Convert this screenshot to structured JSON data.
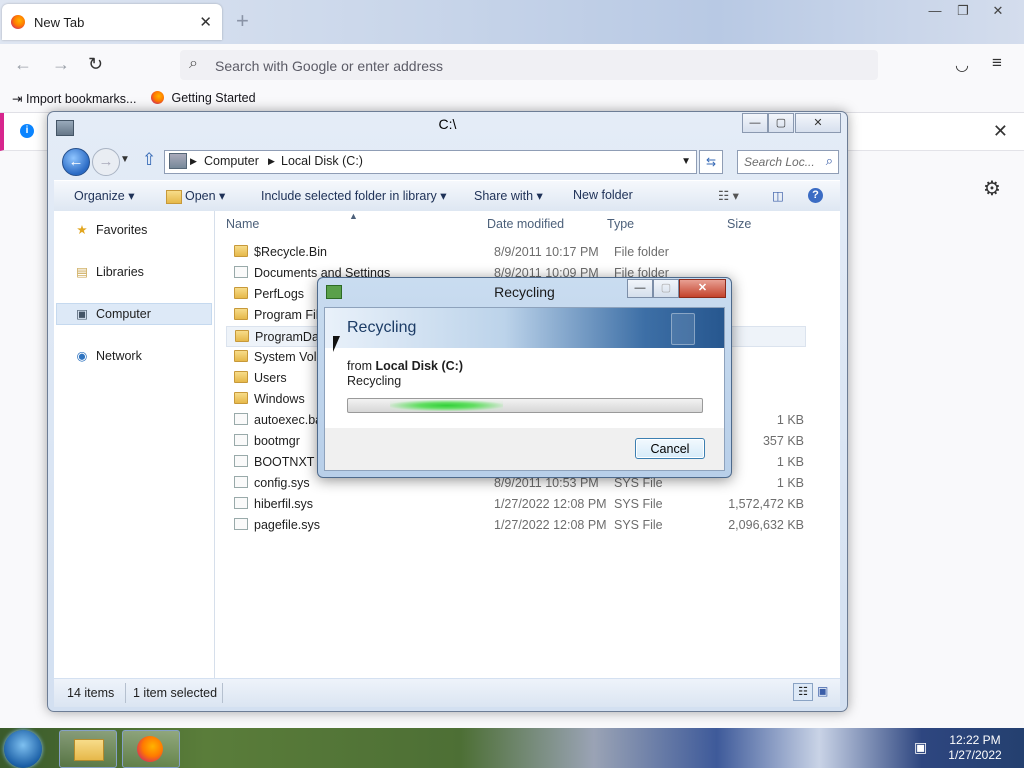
{
  "browser": {
    "tab_title": "New Tab",
    "tab_close": "✕",
    "new_tab": "+",
    "url_placeholder": "Search with Google or enter address",
    "bookmarks": [
      "Import bookmarks...",
      "Getting Started"
    ],
    "window_controls": [
      "—",
      "❐",
      "✕"
    ]
  },
  "explorer": {
    "title": "C:\\",
    "breadcrumb": [
      "Computer",
      "Local Disk (C:)"
    ],
    "search_placeholder": "Search Loc...",
    "toolbar": {
      "organize": "Organize ▾",
      "open": "Open ▾",
      "include": "Include selected folder in library ▾",
      "share": "Share with ▾",
      "new_folder": "New folder"
    },
    "nav": [
      "Favorites",
      "Libraries",
      "Computer",
      "Network"
    ],
    "columns": [
      "Name",
      "Date modified",
      "Type",
      "Size"
    ],
    "rows": [
      {
        "name": "$Recycle.Bin",
        "date": "8/9/2011 10:17 PM",
        "type": "File folder",
        "size": ""
      },
      {
        "name": "Documents and Settings",
        "date": "8/9/2011 10:09 PM",
        "type": "File folder",
        "size": ""
      },
      {
        "name": "PerfLogs",
        "date": "",
        "type": "",
        "size": ""
      },
      {
        "name": "Program Files",
        "date": "",
        "type": "",
        "size": ""
      },
      {
        "name": "ProgramData",
        "date": "",
        "type": "",
        "size": ""
      },
      {
        "name": "System Volume Information",
        "date": "",
        "type": "",
        "size": ""
      },
      {
        "name": "Users",
        "date": "",
        "type": "",
        "size": ""
      },
      {
        "name": "Windows",
        "date": "",
        "type": "",
        "size": ""
      },
      {
        "name": "autoexec.bat",
        "date": "",
        "type": "",
        "size": "1 KB"
      },
      {
        "name": "bootmgr",
        "date": "",
        "type": "",
        "size": "357 KB"
      },
      {
        "name": "BOOTNXT",
        "date": "",
        "type": "",
        "size": "1 KB"
      },
      {
        "name": "config.sys",
        "date": "8/9/2011 10:53 PM",
        "type": "SYS File",
        "size": "1 KB"
      },
      {
        "name": "hiberfil.sys",
        "date": "1/27/2022 12:08 PM",
        "type": "SYS File",
        "size": "1,572,472 KB"
      },
      {
        "name": "pagefile.sys",
        "date": "1/27/2022 12:08 PM",
        "type": "SYS File",
        "size": "2,096,632 KB"
      }
    ],
    "status_items": "14 items",
    "status_selected": "1 item selected"
  },
  "dialog": {
    "title": "Recycling",
    "heading": "Recycling",
    "from_prefix": "from ",
    "from_location": "Local Disk (C:)",
    "status": "Recycling",
    "cancel": "Cancel",
    "progress": 0.2
  },
  "taskbar": {
    "time": "12:22 PM",
    "date": "1/27/2022"
  }
}
